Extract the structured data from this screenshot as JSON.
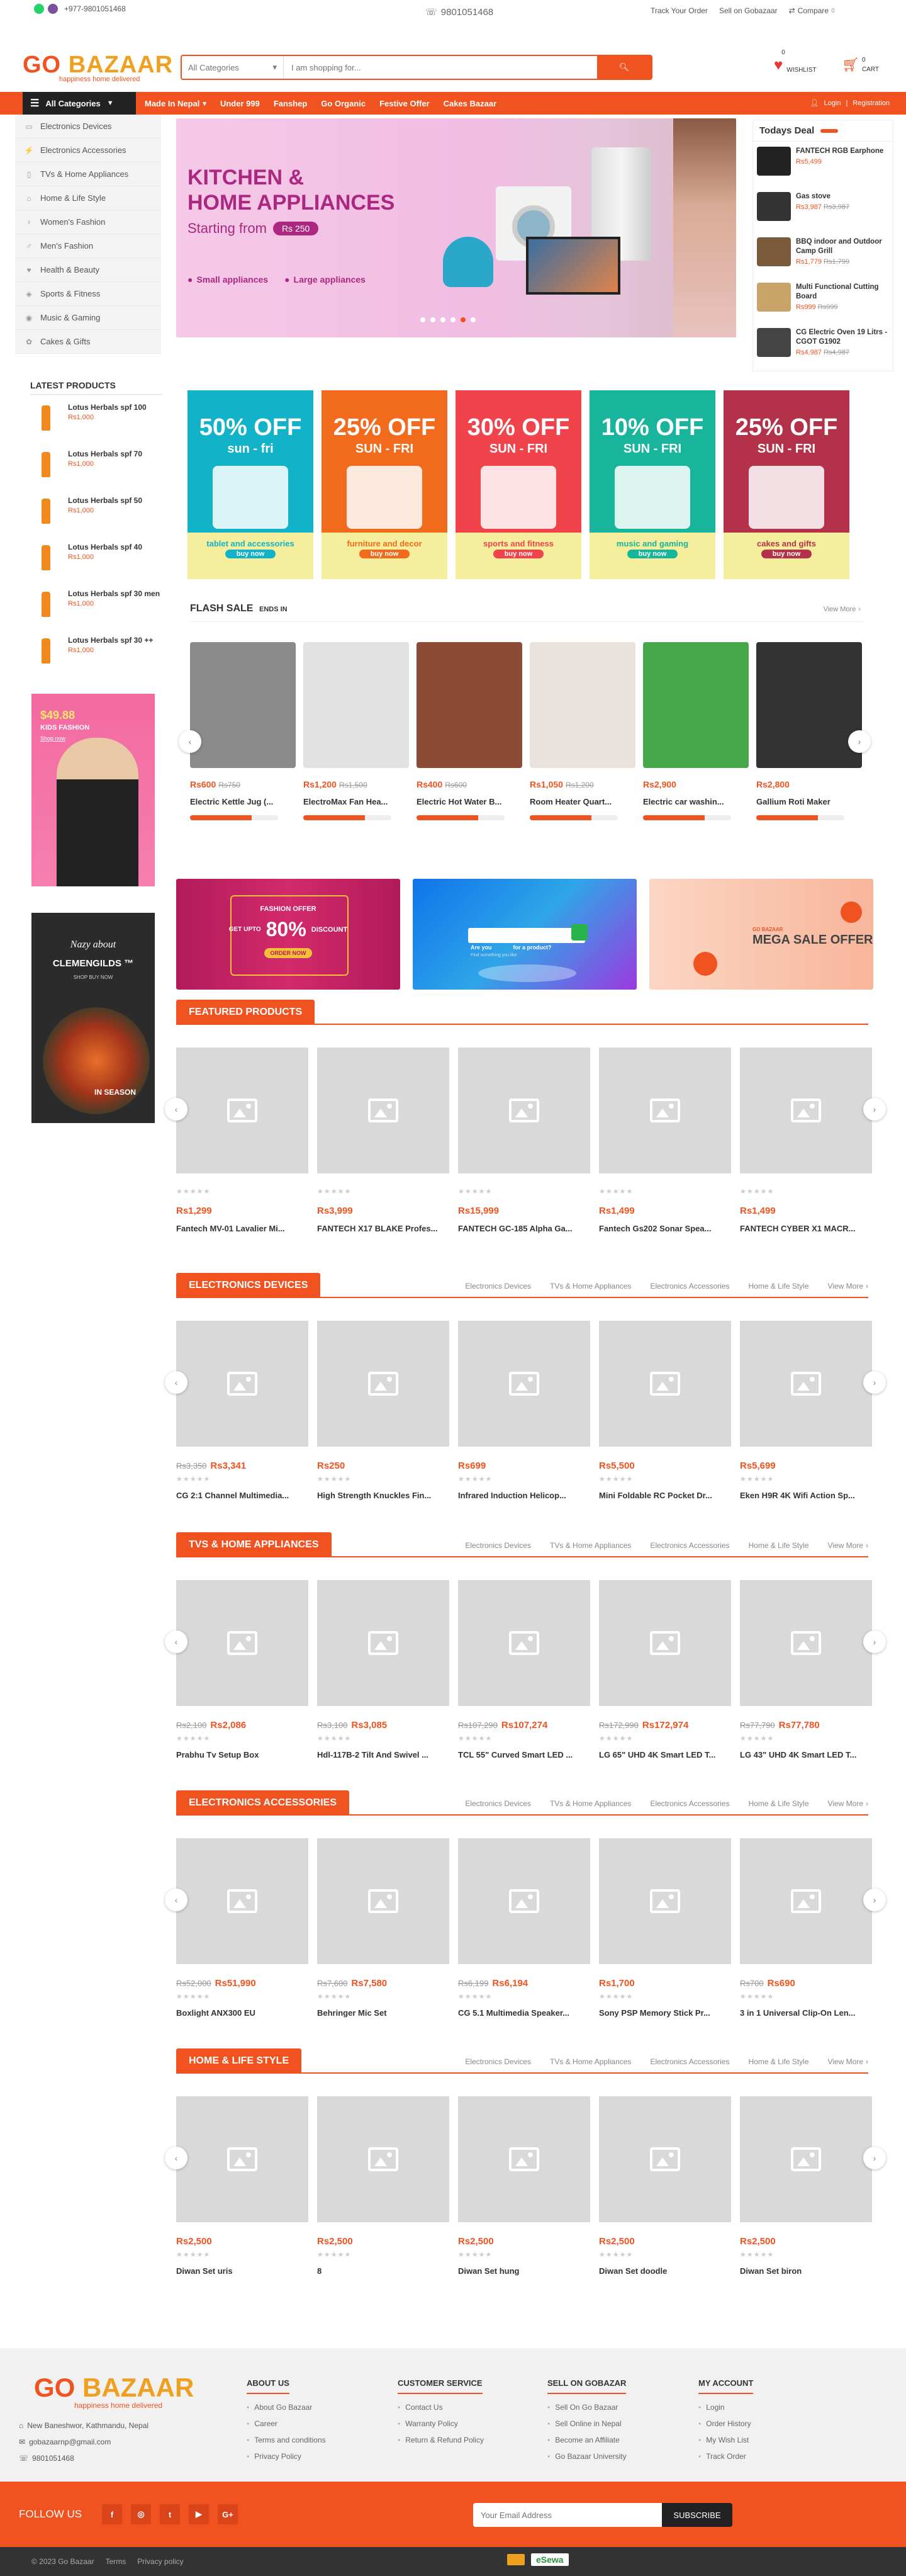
{
  "topbar": {
    "whatsapp_icon": "whatsapp-icon",
    "viber_icon": "viber-icon",
    "phone_small": "+977-9801051468",
    "phone_center": "9801051468",
    "track": "Track Your Order",
    "sell": "Sell on Gobazaar",
    "compare": "Compare",
    "compare_count": "0"
  },
  "header": {
    "logo_go": "GO",
    "logo_bazaar": "BAZAAR",
    "tagline": "happiness home delivered",
    "search_category": "All Categories",
    "search_placeholder": "I am shopping for...",
    "wishlist": "WISHLIST",
    "wishlist_count": "0",
    "cart": "CART",
    "cart_count": "0",
    "login": "Login",
    "register": "Registration"
  },
  "nav": {
    "all_categories": "All Categories",
    "links": [
      "Made In Nepal",
      "Under 999",
      "Fanshep",
      "Go Organic",
      "Festive Offer",
      "Cakes Bazaar"
    ]
  },
  "sidebar_categories": [
    "Electronics Devices",
    "Electronics Accessories",
    "TVs & Home Appliances",
    "Home & Life Style",
    "Women's Fashion",
    "Men's Fashion",
    "Health & Beauty",
    "Sports & Fitness",
    "Music & Gaming",
    "Cakes & Gifts"
  ],
  "hero": {
    "line1": "KITCHEN &",
    "line2": "HOME APPLIANCES",
    "starting": "Starting from",
    "price": "Rs 250",
    "bullet1": "Small appliances",
    "bullet2": "Large appliances"
  },
  "todays_deal": {
    "title": "Todays Deal",
    "items": [
      {
        "name": "FANTECH RGB Earphone",
        "price": "Rs5,499",
        "old": ""
      },
      {
        "name": "Gas stove",
        "price": "Rs3,987",
        "old": "Rs3,987"
      },
      {
        "name": "BBQ indoor and Outdoor Camp Grill",
        "price": "Rs1,779",
        "old": "Rs1,799"
      },
      {
        "name": "Multi Functional Cutting Board",
        "price": "Rs999",
        "old": "Rs999"
      },
      {
        "name": "CG Electric Oven 19 Litrs -CGOT G1902",
        "price": "Rs4,987",
        "old": "Rs4,987"
      }
    ]
  },
  "latest_products": {
    "title": "LATEST PRODUCTS",
    "items": [
      {
        "name": "Lotus Herbals spf 100",
        "price": "Rs1,000"
      },
      {
        "name": "Lotus Herbals spf 70",
        "price": "Rs1,000"
      },
      {
        "name": "Lotus Herbals spf 50",
        "price": "Rs1,000"
      },
      {
        "name": "Lotus Herbals spf 40",
        "price": "Rs1,000"
      },
      {
        "name": "Lotus Herbals spf 30 men",
        "price": "Rs1,000"
      },
      {
        "name": "Lotus Herbals spf 30 ++",
        "price": "Rs1,000"
      }
    ]
  },
  "side_ads": {
    "kids_price": "$49.88",
    "kids_label": "KIDS FASHION",
    "kids_shop": "Shop now",
    "clem_line1": "Nazy about",
    "clem_line2": "CLEMENGILDS ™",
    "clem_line3": "SHOP BUY NOW",
    "clem_line4": "IN SEASON"
  },
  "promo_tiles": [
    {
      "pct": "50% OFF",
      "days": "sun - fri",
      "cat": "tablet and accessories",
      "buy": "buy now",
      "bg": "#12b3c9",
      "foot": "#f5ee9c"
    },
    {
      "pct": "25% OFF",
      "days": "SUN - FRI",
      "cat": "furniture and decor",
      "buy": "buy now",
      "bg": "#f26a1b",
      "foot": "#f5ee9c"
    },
    {
      "pct": "30% OFF",
      "days": "SUN - FRI",
      "cat": "sports and fitness",
      "buy": "buy now",
      "bg": "#f0434c",
      "foot": "#f5ee9c"
    },
    {
      "pct": "10% OFF",
      "days": "SUN - FRI",
      "cat": "music and gaming",
      "buy": "buy now",
      "bg": "#19b49c",
      "foot": "#f5ee9c"
    },
    {
      "pct": "25% OFF",
      "days": "SUN - FRI",
      "cat": "cakes and gifts",
      "buy": "buy now",
      "bg": "#b3324a",
      "foot": "#f5ee9c"
    }
  ],
  "flash_sale": {
    "title": "FLASH SALE",
    "ends": "ENDS IN",
    "view_more": "View More",
    "items": [
      {
        "price": "Rs600",
        "old": "Rs750",
        "name": "Electric Kettle Jug (..."
      },
      {
        "price": "Rs1,200",
        "old": "Rs1,500",
        "name": "ElectroMax Fan Hea..."
      },
      {
        "price": "Rs400",
        "old": "Rs600",
        "name": "Electric Hot Water B..."
      },
      {
        "price": "Rs1,050",
        "old": "Rs1,200",
        "name": "Room Heater Quart..."
      },
      {
        "price": "Rs2,900",
        "old": "",
        "name": "Electric car washin..."
      },
      {
        "price": "Rs2,800",
        "old": "",
        "name": "Gallium Roti Maker"
      }
    ]
  },
  "banners": {
    "b1_small": "FASHION OFFER",
    "b1_upto": "GET UPTO",
    "b1_pct": "80%",
    "b1_disc": "DISCOUNT",
    "b1_order": "ORDER NOW",
    "b2_are": "Are you",
    "b2_for": "for a product?",
    "b2_find": "Find something you like",
    "b3_brand": "GO BAZAAR",
    "b3_mega": "MEGA SALE OFFER"
  },
  "tabs": [
    "Electronics Devices",
    "TVs & Home Appliances",
    "Electronics Accessories",
    "Home & Life Style"
  ],
  "view_more": "View More",
  "sections": [
    {
      "title": "FEATURED PRODUCTS",
      "has_tabs": false,
      "items": [
        {
          "price": "Rs1,299",
          "old": "",
          "name": "Fantech MV-01 Lavalier Mi..."
        },
        {
          "price": "Rs3,999",
          "old": "",
          "name": "FANTECH X17 BLAKE Profes..."
        },
        {
          "price": "Rs15,999",
          "old": "",
          "name": "FANTECH GC-185 Alpha Ga..."
        },
        {
          "price": "Rs1,499",
          "old": "",
          "name": "Fantech Gs202 Sonar Spea..."
        },
        {
          "price": "Rs1,499",
          "old": "",
          "name": "FANTECH CYBER X1 MACR..."
        }
      ]
    },
    {
      "title": "ELECTRONICS DEVICES",
      "has_tabs": true,
      "items": [
        {
          "price": "Rs3,341",
          "old": "Rs3,350",
          "name": "CG 2:1 Channel Multimedia..."
        },
        {
          "price": "Rs250",
          "old": "",
          "name": "High Strength Knuckles Fin..."
        },
        {
          "price": "Rs699",
          "old": "",
          "name": "Infrared Induction Helicop..."
        },
        {
          "price": "Rs5,500",
          "old": "",
          "name": "Mini Foldable RC Pocket Dr..."
        },
        {
          "price": "Rs5,699",
          "old": "",
          "name": "Eken H9R 4K Wifi Action Sp..."
        }
      ]
    },
    {
      "title": "TVS & HOME APPLIANCES",
      "has_tabs": true,
      "items": [
        {
          "price": "Rs2,086",
          "old": "Rs2,100",
          "name": "Prabhu Tv Setup Box"
        },
        {
          "price": "Rs3,085",
          "old": "Rs3,100",
          "name": "Hdl-117B-2 Tilt And Swivel ..."
        },
        {
          "price": "Rs107,274",
          "old": "Rs107,290",
          "name": "TCL 55\" Curved Smart LED ..."
        },
        {
          "price": "Rs172,974",
          "old": "Rs172,990",
          "name": "LG 65\" UHD 4K Smart LED T..."
        },
        {
          "price": "Rs77,780",
          "old": "Rs77,790",
          "name": "LG 43\" UHD 4K Smart LED T..."
        }
      ]
    },
    {
      "title": "ELECTRONICS ACCESSORIES",
      "has_tabs": true,
      "items": [
        {
          "price": "Rs51,990",
          "old": "Rs52,000",
          "name": "Boxlight ANX300 EU"
        },
        {
          "price": "Rs7,580",
          "old": "Rs7,600",
          "name": "Behringer Mic Set"
        },
        {
          "price": "Rs6,194",
          "old": "Rs6,199",
          "name": "CG 5.1 Multimedia Speaker..."
        },
        {
          "price": "Rs1,700",
          "old": "",
          "name": "Sony PSP Memory Stick Pr..."
        },
        {
          "price": "Rs690",
          "old": "Rs700",
          "name": "3 in 1 Universal Clip-On Len..."
        }
      ]
    },
    {
      "title": "HOME & LIFE STYLE",
      "has_tabs": true,
      "items": [
        {
          "price": "Rs2,500",
          "old": "",
          "name": "Diwan Set uris"
        },
        {
          "price": "Rs2,500",
          "old": "",
          "name": "8"
        },
        {
          "price": "Rs2,500",
          "old": "",
          "name": "Diwan Set hung"
        },
        {
          "price": "Rs2,500",
          "old": "",
          "name": "Diwan Set doodle"
        },
        {
          "price": "Rs2,500",
          "old": "",
          "name": "Diwan Set biron"
        }
      ]
    }
  ],
  "footer": {
    "address": "New Baneshwor, Kathmandu, Nepal",
    "email": "gobazaarnp@gmail.com",
    "phone": "9801051468",
    "cols": [
      {
        "h": "ABOUT US",
        "links": [
          "About Go Bazaar",
          "Career",
          "Terms and conditions",
          "Privacy Policy"
        ]
      },
      {
        "h": "CUSTOMER SERVICE",
        "links": [
          "Contact Us",
          "Warranty Policy",
          "Return & Refund Policy"
        ]
      },
      {
        "h": "SELL ON GOBAZAR",
        "links": [
          "Sell On Go Bazaar",
          "Sell Online in Nepal",
          "Become an Affiliate",
          "Go Bazaar University"
        ]
      },
      {
        "h": "MY ACCOUNT",
        "links": [
          "Login",
          "Order History",
          "My Wish List",
          "Track Order"
        ]
      }
    ]
  },
  "follow": {
    "label": "FOLLOW US",
    "email_placeholder": "Your Email Address",
    "subscribe": "SUBSCRIBE",
    "icons": [
      "facebook-icon",
      "instagram-icon",
      "twitter-icon",
      "youtube-icon",
      "google-plus-icon"
    ]
  },
  "bottom": {
    "copy": "© 2023 Go Bazaar",
    "terms": "Terms",
    "privacy": "Privacy policy",
    "esewa": "eSewa"
  },
  "colors": {
    "accent": "#f0531f",
    "dark": "#222222"
  }
}
